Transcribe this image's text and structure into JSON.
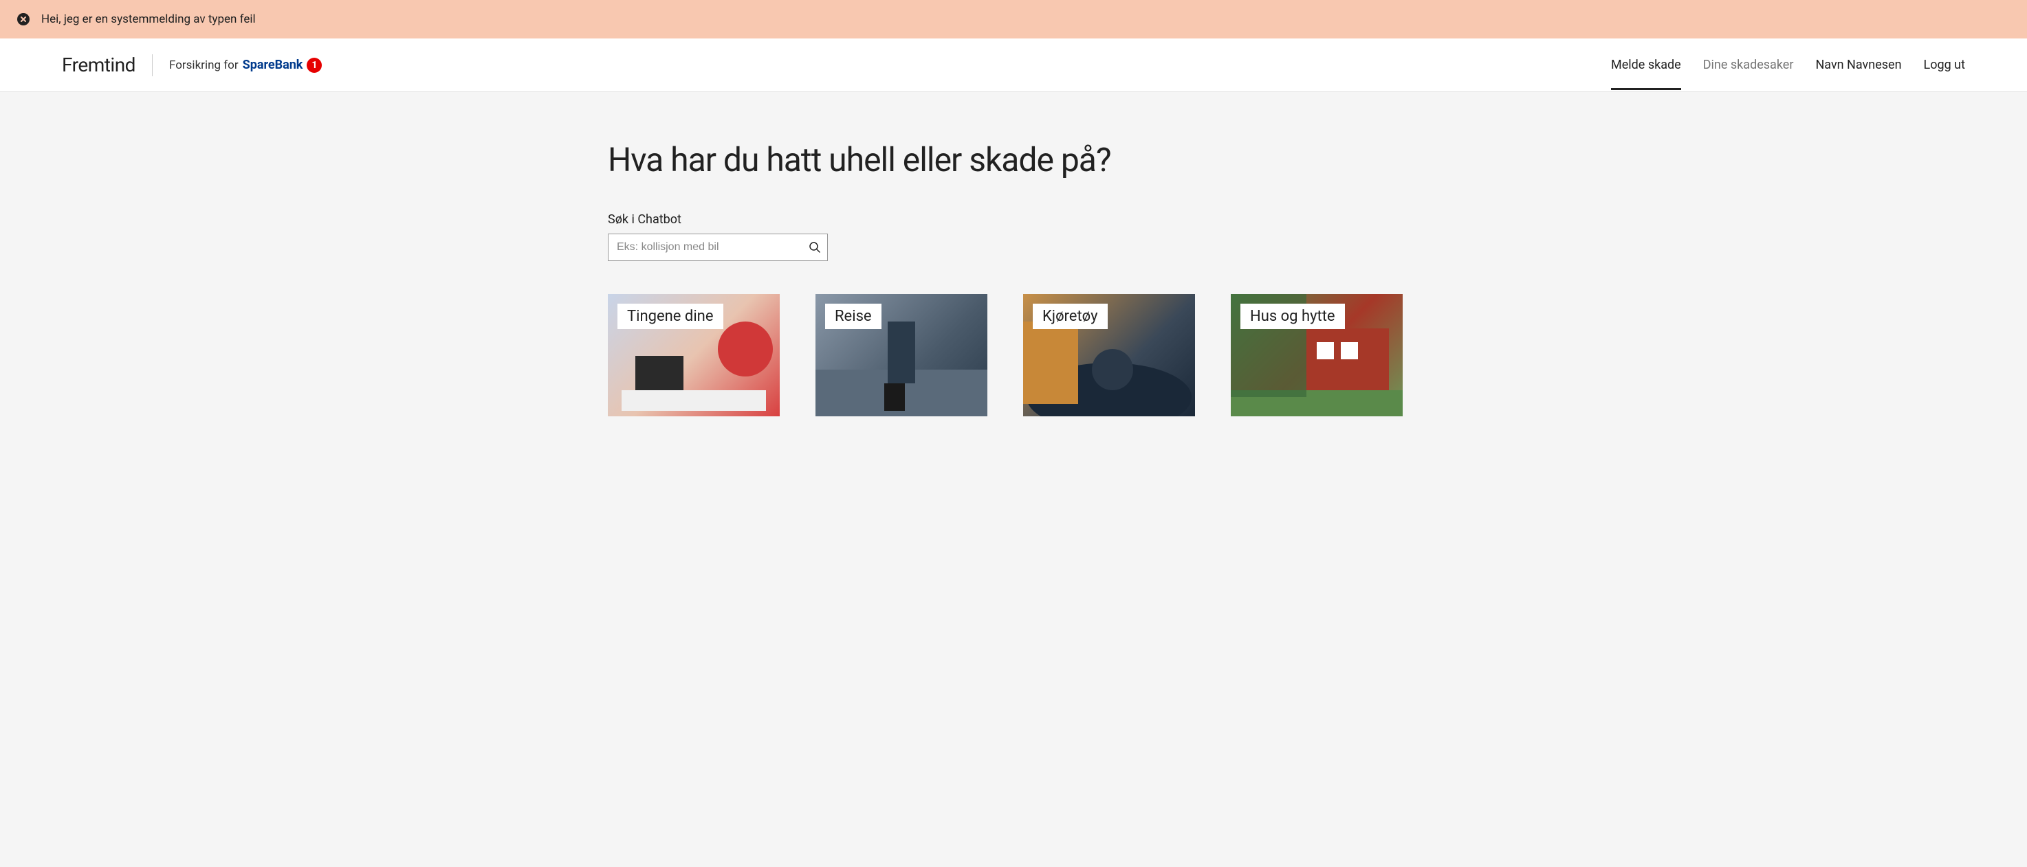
{
  "alert": {
    "message": "Hei, jeg er en systemmelding av typen feil"
  },
  "brand": {
    "name": "Fremtind",
    "partner_prefix": "Forsikring for",
    "partner_name": "SpareBank",
    "partner_badge": "1"
  },
  "nav": {
    "items": [
      {
        "label": "Melde skade",
        "active": true,
        "muted": false
      },
      {
        "label": "Dine skadesaker",
        "active": false,
        "muted": true
      },
      {
        "label": "Navn Navnesen",
        "active": false,
        "muted": false
      },
      {
        "label": "Logg ut",
        "active": false,
        "muted": false
      }
    ]
  },
  "main": {
    "title": "Hva har du hatt uhell eller skade på?",
    "search": {
      "label": "Søk i Chatbot",
      "placeholder": "Eks: kollisjon med bil"
    },
    "categories": [
      {
        "label": "Tingene dine",
        "img_class": "img-things"
      },
      {
        "label": "Reise",
        "img_class": "img-travel"
      },
      {
        "label": "Kjøretøy",
        "img_class": "img-vehicle"
      },
      {
        "label": "Hus og hytte",
        "img_class": "img-house"
      }
    ]
  }
}
